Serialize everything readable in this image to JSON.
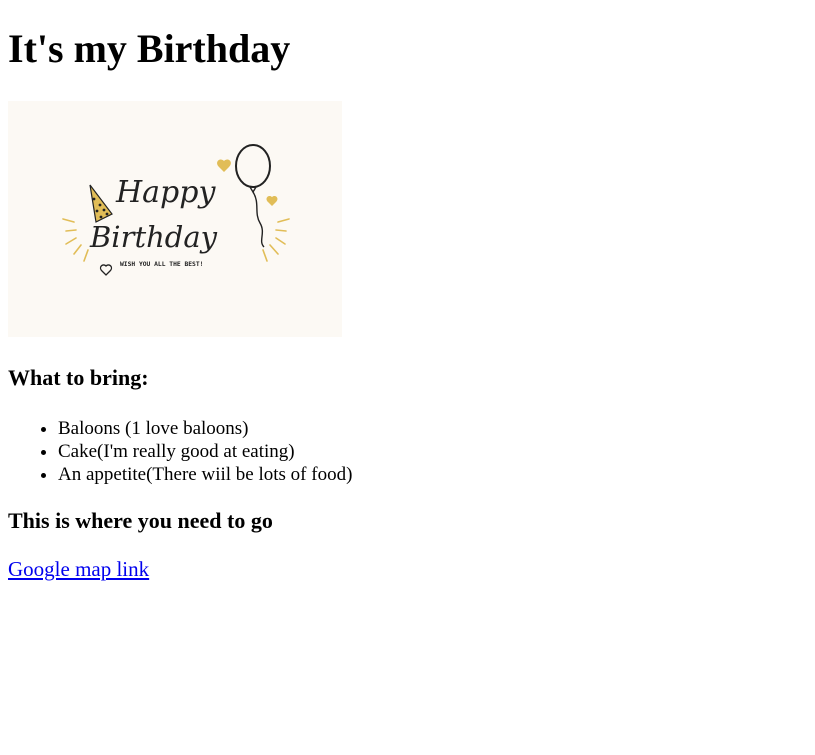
{
  "page": {
    "title": "It's my Birthday",
    "card": {
      "script_line1": "Happy",
      "script_line2": "Birthday",
      "tagline": "WISH YOU ALL THE BEST!"
    },
    "bring_heading": "What to bring:",
    "bring_items": [
      "Baloons (1 love baloons)",
      "Cake(I'm really good at eating)",
      "An appetite(There wiil be lots of food)"
    ],
    "go_heading": "This is where you need to go",
    "map_link_label": "Google map link"
  },
  "colors": {
    "card_background": "#fcf9f4",
    "gold_accent": "#e1bd57",
    "link": "#0000ee"
  }
}
